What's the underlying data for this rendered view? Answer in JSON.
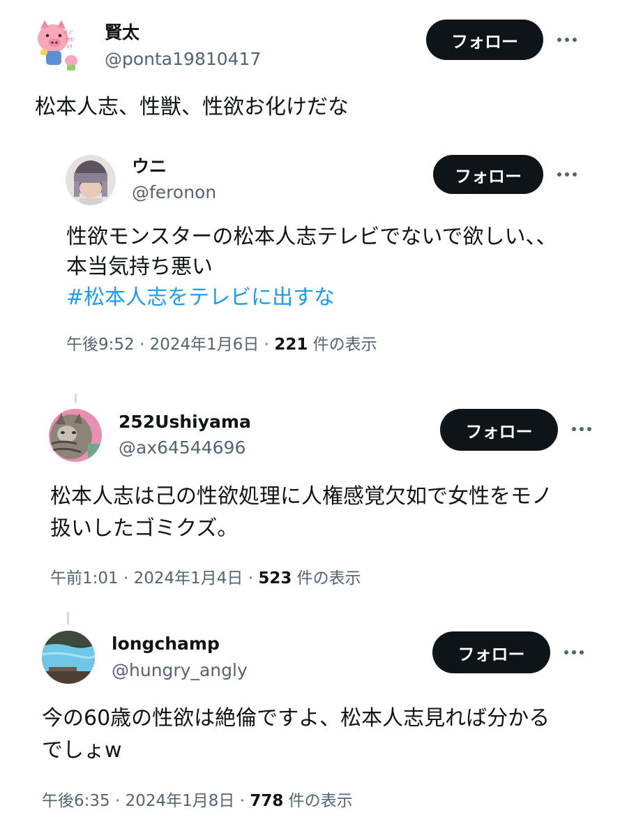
{
  "tweets": [
    {
      "name": "賢太",
      "handle": "@ponta19810417",
      "follow_label": "フォロー",
      "text_lines": [
        "松本人志、性獣、性欲お化けだな"
      ]
    },
    {
      "name": "ウニ",
      "handle": "@feronon",
      "follow_label": "フォロー",
      "text_lines": [
        "性欲モンスターの松本人志テレビでないで欲しい、、",
        "本当気持ち悪い"
      ],
      "hashtag": "#松本人志をテレビに出すな",
      "time": "午後9:52",
      "date": "2024年1月6日",
      "views": "221",
      "views_label": "件の表示"
    },
    {
      "name": "252Ushiyama",
      "handle": "@ax64544696",
      "follow_label": "フォロー",
      "text_lines": [
        "松本人志は己の性欲処理に人権感覚欠如で女性をモノ",
        "扱いしたゴミクズ。"
      ],
      "time": "午前1:01",
      "date": "2024年1月4日",
      "views": "523",
      "views_label": "件の表示"
    },
    {
      "name": "longchamp",
      "handle": "@hungry_angly",
      "follow_label": "フォロー",
      "text_lines": [
        "今の60歳の性欲は絶倫ですよ、松本人志見れば分かる",
        "でしょw"
      ],
      "time": "午後6:35",
      "date": "2024年1月8日",
      "views": "778",
      "views_label": "件の表示"
    }
  ],
  "icons": {
    "more": "more-horizontal-icon"
  },
  "colors": {
    "follow_button": "#0f1419",
    "hashtag": "#1d9bf0",
    "secondary_text": "#536471"
  }
}
